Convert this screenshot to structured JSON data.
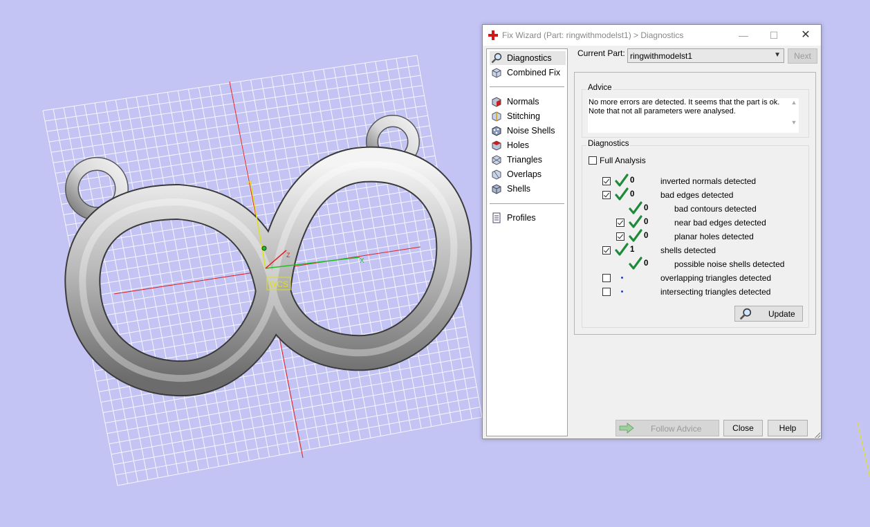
{
  "dialog": {
    "title": "Fix Wizard (Part: ringwithmodelst1) > Diagnostics",
    "window_controls": [
      "minimize",
      "maximize",
      "close"
    ]
  },
  "nav": {
    "items": [
      {
        "label": "Diagnostics",
        "icon": "magnifier-icon",
        "selected": true
      },
      {
        "label": "Combined Fix",
        "icon": "combined-fix-icon"
      },
      {
        "label": "Normals",
        "icon": "normals-icon"
      },
      {
        "label": "Stitching",
        "icon": "stitching-icon"
      },
      {
        "label": "Noise Shells",
        "icon": "noise-shells-icon"
      },
      {
        "label": "Holes",
        "icon": "holes-icon"
      },
      {
        "label": "Triangles",
        "icon": "triangles-icon"
      },
      {
        "label": "Overlaps",
        "icon": "overlaps-icon"
      },
      {
        "label": "Shells",
        "icon": "shells-icon"
      },
      {
        "label": "Profiles",
        "icon": "profiles-icon"
      }
    ]
  },
  "current_part": {
    "label": "Current Part:",
    "value": "ringwithmodelst1",
    "next_label": "Next"
  },
  "advice": {
    "title": "Advice",
    "line1": "No more errors are detected. It seems that the part is ok.",
    "line2": "Note that not all parameters were analysed."
  },
  "diagnostics": {
    "title": "Diagnostics",
    "full_analysis_label": "Full Analysis",
    "full_analysis_checked": false,
    "rows": [
      {
        "label": "inverted normals detected",
        "count": "0",
        "checked": true,
        "status": "ok"
      },
      {
        "label": "bad edges detected",
        "count": "0",
        "checked": true,
        "status": "ok"
      },
      {
        "label": "bad contours detected",
        "count": "0",
        "checked": null,
        "status": "ok"
      },
      {
        "label": "near bad edges detected",
        "count": "0",
        "checked": true,
        "status": "ok"
      },
      {
        "label": "planar holes detected",
        "count": "0",
        "checked": true,
        "status": "ok"
      },
      {
        "label": "shells detected",
        "count": "1",
        "checked": true,
        "status": "ok"
      },
      {
        "label": "possible noise shells detected",
        "count": "0",
        "checked": null,
        "status": "ok"
      },
      {
        "label": "overlapping triangles detected",
        "count": "",
        "checked": false,
        "status": "not-analysed"
      },
      {
        "label": "intersecting triangles detected",
        "count": "",
        "checked": false,
        "status": "not-analysed"
      }
    ],
    "update_label": "Update"
  },
  "buttons": {
    "follow_advice": "Follow Advice",
    "close": "Close",
    "help": "Help"
  },
  "viewport": {
    "wcs_label": "WCS",
    "axis_x": "X",
    "axis_y": "Y",
    "axis_z": "Z"
  },
  "colors": {
    "background": "#c4c4f4",
    "grid": "#ffffff",
    "axis_red": "#e02020",
    "axis_green": "#20c020",
    "axis_yellow": "#e0e020",
    "check_green": "#1e8a3a"
  }
}
